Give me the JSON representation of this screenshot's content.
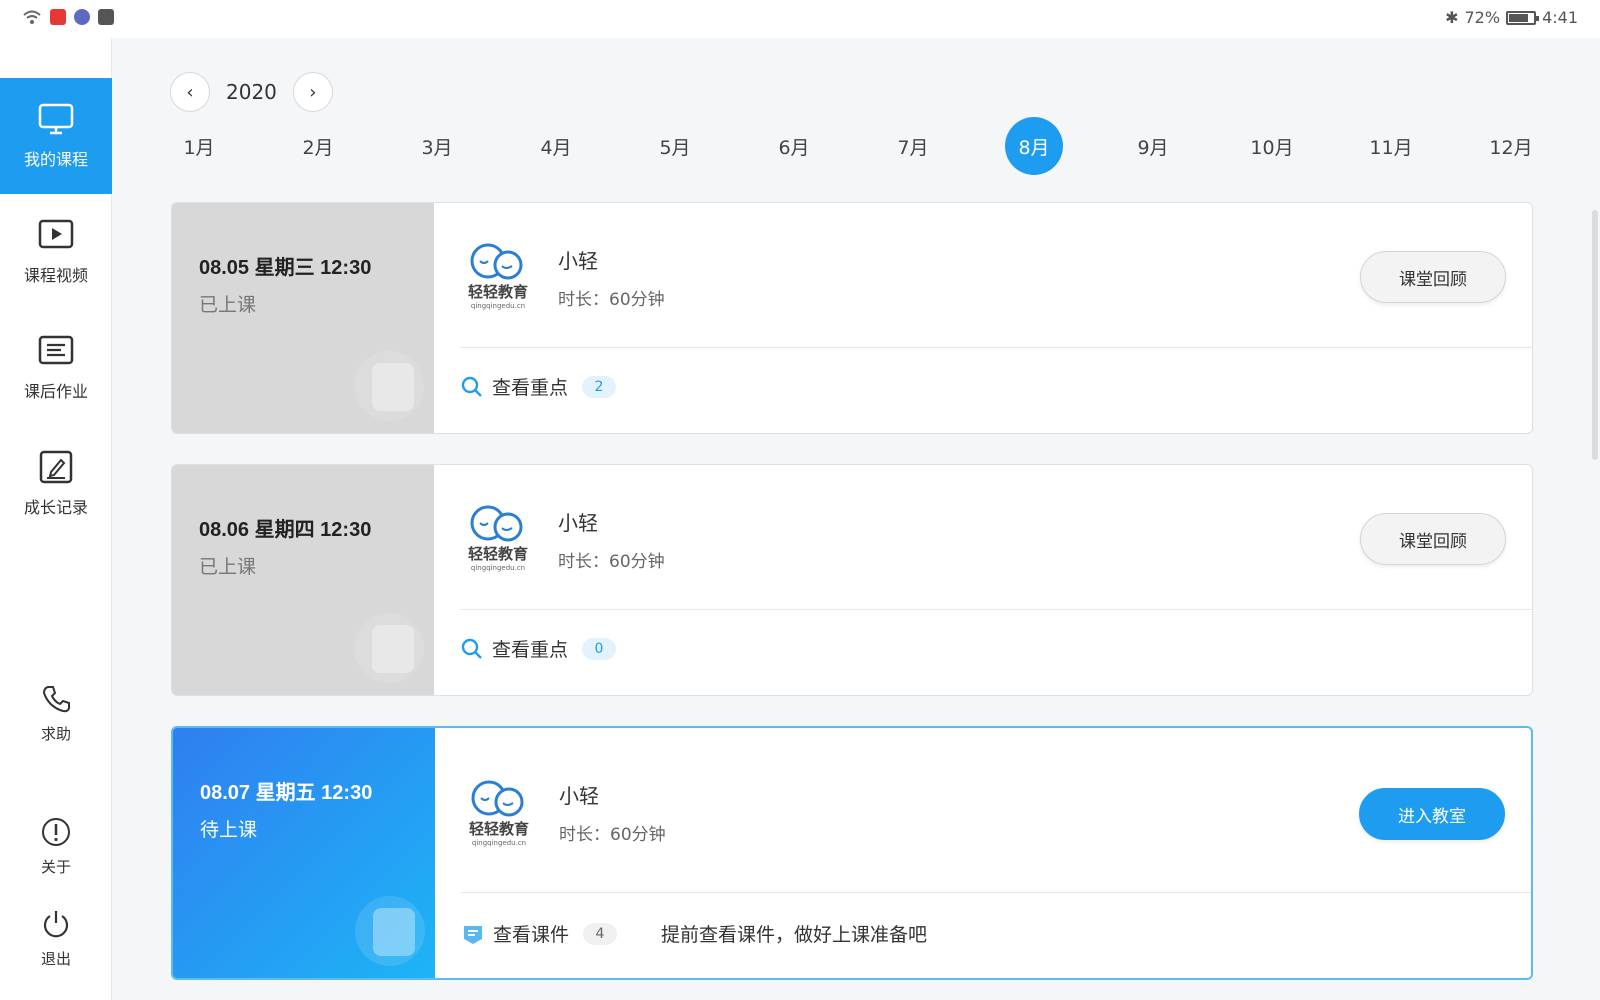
{
  "status_bar": {
    "battery": "72%",
    "time": "4:41",
    "battery_level": 0.72
  },
  "sidebar": {
    "items": [
      {
        "label": "我的课程",
        "icon": "monitor-icon"
      },
      {
        "label": "课程视频",
        "icon": "play-video-icon"
      },
      {
        "label": "课后作业",
        "icon": "homework-icon"
      },
      {
        "label": "成长记录",
        "icon": "edit-record-icon"
      }
    ],
    "bottom": [
      {
        "label": "求助",
        "icon": "phone-icon"
      },
      {
        "label": "关于",
        "icon": "info-icon"
      },
      {
        "label": "退出",
        "icon": "power-icon"
      }
    ]
  },
  "calendar": {
    "year": "2020",
    "months": [
      "1月",
      "2月",
      "3月",
      "4月",
      "5月",
      "6月",
      "7月",
      "8月",
      "9月",
      "10月",
      "11月",
      "12月"
    ],
    "selected_month": "8月"
  },
  "courses": [
    {
      "date": "08.05 星期三 12:30",
      "status": "已上课",
      "teacher": "小轻",
      "duration": "时长：60分钟",
      "action": "课堂回顾",
      "bottom_label": "查看重点",
      "bottom_count": "2",
      "tip": ""
    },
    {
      "date": "08.06 星期四 12:30",
      "status": "已上课",
      "teacher": "小轻",
      "duration": "时长：60分钟",
      "action": "课堂回顾",
      "bottom_label": "查看重点",
      "bottom_count": "0",
      "tip": ""
    },
    {
      "date": "08.07 星期五 12:30",
      "status": "待上课",
      "teacher": "小轻",
      "duration": "时长：60分钟",
      "action": "进入教室",
      "bottom_label": "查看课件",
      "bottom_count": "4",
      "tip": "提前查看课件，做好上课准备吧"
    }
  ],
  "logo_text": "轻轻教育",
  "logo_subtext": "qingqingedu.cn",
  "colors": {
    "accent": "#1e9cf0",
    "past_card": "#d8d8d8",
    "current_card": "#2f7ff0"
  }
}
